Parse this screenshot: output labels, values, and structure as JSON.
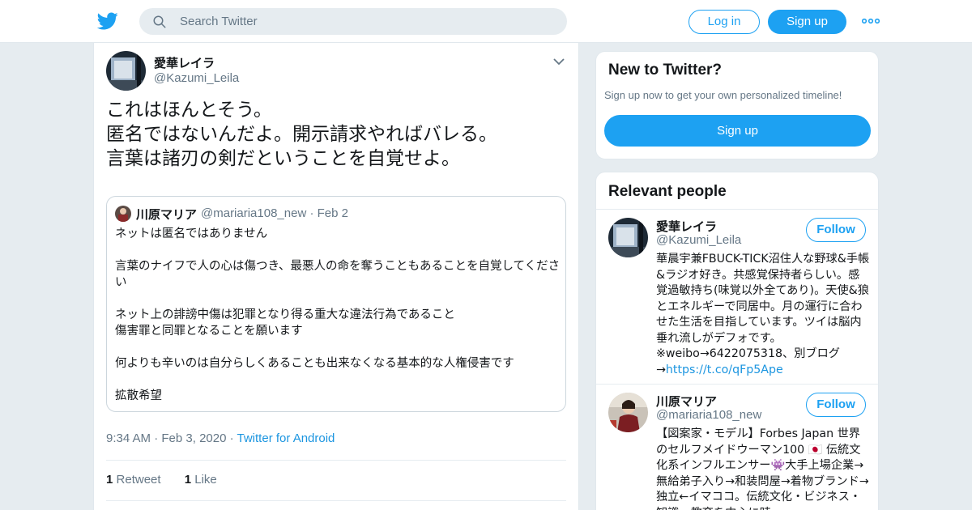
{
  "colors": {
    "accent": "#1da1f2",
    "link": "#1b95e0",
    "muted": "#657786",
    "background": "#e6ecf0"
  },
  "header": {
    "logo_icon": "twitter-bird-icon",
    "search_placeholder": "Search Twitter",
    "login_label": "Log in",
    "signup_label": "Sign up",
    "more_icon": "more-dots-icon"
  },
  "tweet": {
    "name": "愛華レイラ",
    "handle": "@Kazumi_Leila",
    "text_lines": [
      "これはほんとそう。",
      "匿名ではないんだよ。開示請求やればバレる。",
      "言葉は諸刃の剣だということを自覚せよ。"
    ],
    "quote": {
      "name": "川原マリア",
      "handle": "@mariaria108_new",
      "date": "Feb 2",
      "paragraphs": [
        "ネットは匿名ではありません",
        "言葉のナイフで人の心は傷つき、最悪人の命を奪うこともあることを自覚してください",
        "ネット上の誹謗中傷は犯罪となり得る重大な違法行為であること\n傷害罪と同罪となることを願います",
        "何よりも辛いのは自分らしくあることも出来なくなる基本的な人権侵害です",
        "拡散希望"
      ]
    },
    "time": "9:34 AM",
    "date": "Feb 3, 2020",
    "source": "Twitter for Android",
    "retweets_count": "1",
    "retweets_label": "Retweet",
    "likes_count": "1",
    "likes_label": "Like"
  },
  "sidebar": {
    "new_title": "New to Twitter?",
    "new_sub": "Sign up now to get your own personalized timeline!",
    "new_signup": "Sign up",
    "relevant_title": "Relevant people",
    "people": [
      {
        "name": "愛華レイラ",
        "handle": "@Kazumi_Leila",
        "follow": "Follow",
        "bio": "華晨宇兼FBUCK-TICK沼住人な野球&手帳&ラジオ好き。共感覚保持者らしい。感覚過敏持ち(味覚以外全てあり)。天使&狼とエネルギーで同居中。月の運行に合わせた生活を目指しています。ツイは脳内垂れ流しがデフォです。※weibo→6422075318、別ブログ→",
        "link": "https://t.co/qFp5Ape"
      },
      {
        "name": "川原マリア",
        "handle": "@mariaria108_new",
        "follow": "Follow",
        "bio": "【図案家・モデル】Forbes Japan 世界のセルフメイドウーマン100 🇯🇵 伝統文化系インフルエンサー👾大手上場企業→無給弟子入り→和装問屋→着物ブランド→独立←イマココ。伝統文化・ビジネス・知識・教育を中心に時"
      }
    ]
  }
}
